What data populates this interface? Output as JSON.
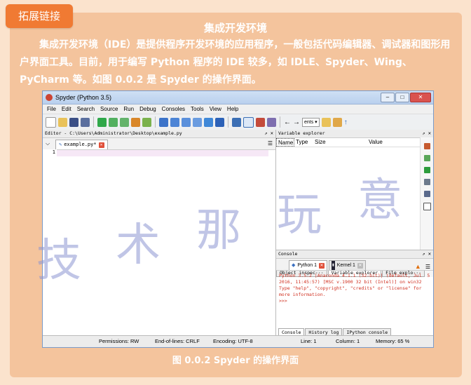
{
  "tag_label": "拓展链接",
  "heading": "集成开发环境",
  "paragraph": "集成开发环境（IDE）是提供程序开发环境的应用程序，一般包括代码编辑器、调试器和图形用户界面工具。目前，用于编写 Python 程序的 IDE 较多，如 IDLE、Spyder、Wing、PyCharm 等。如图 0.0.2 是 Spyder 的操作界面。",
  "caption": "图 0.0.2 Spyder 的操作界面",
  "watermark": [
    "技",
    "术",
    "那",
    "玩",
    "意"
  ],
  "ide": {
    "title": "Spyder (Python 3.5)",
    "menu": [
      "File",
      "Edit",
      "Search",
      "Source",
      "Run",
      "Debug",
      "Consoles",
      "Tools",
      "View",
      "Help"
    ],
    "cwd_value": "ents",
    "editor_title": "Editor - C:\\Users\\Administrator\\Desktop\\example.py",
    "editor_tab": "example.py*",
    "line_number": "1",
    "varx_title": "Variable explorer",
    "var_columns": [
      "Name",
      "Type",
      "Size",
      "Value"
    ],
    "bottom_tabs": [
      "Object inspec···",
      "Variable explorer",
      "File explo···"
    ],
    "console_title": "Console",
    "console_tabs": [
      "Python 1",
      "Kernel 1"
    ],
    "console_text": "Python 3.5.2 |Anaconda 4.1.1 (32-bit)| (default, Jul  5 2016, 11:45:57) [MSC v.1900 32 bit (Intel)] on win32\nType \"help\", \"copyright\", \"credits\" or \"license\" for more information.\n>>>",
    "console_bottom_tabs": [
      "Console",
      "History log",
      "IPython console"
    ],
    "status": {
      "permissions": "Permissions: RW",
      "eol": "End-of-lines: CRLF",
      "encoding": "Encoding: UTF-8",
      "line": "Line: 1",
      "column": "Column: 1",
      "memory": "Memory: 65 %"
    }
  }
}
